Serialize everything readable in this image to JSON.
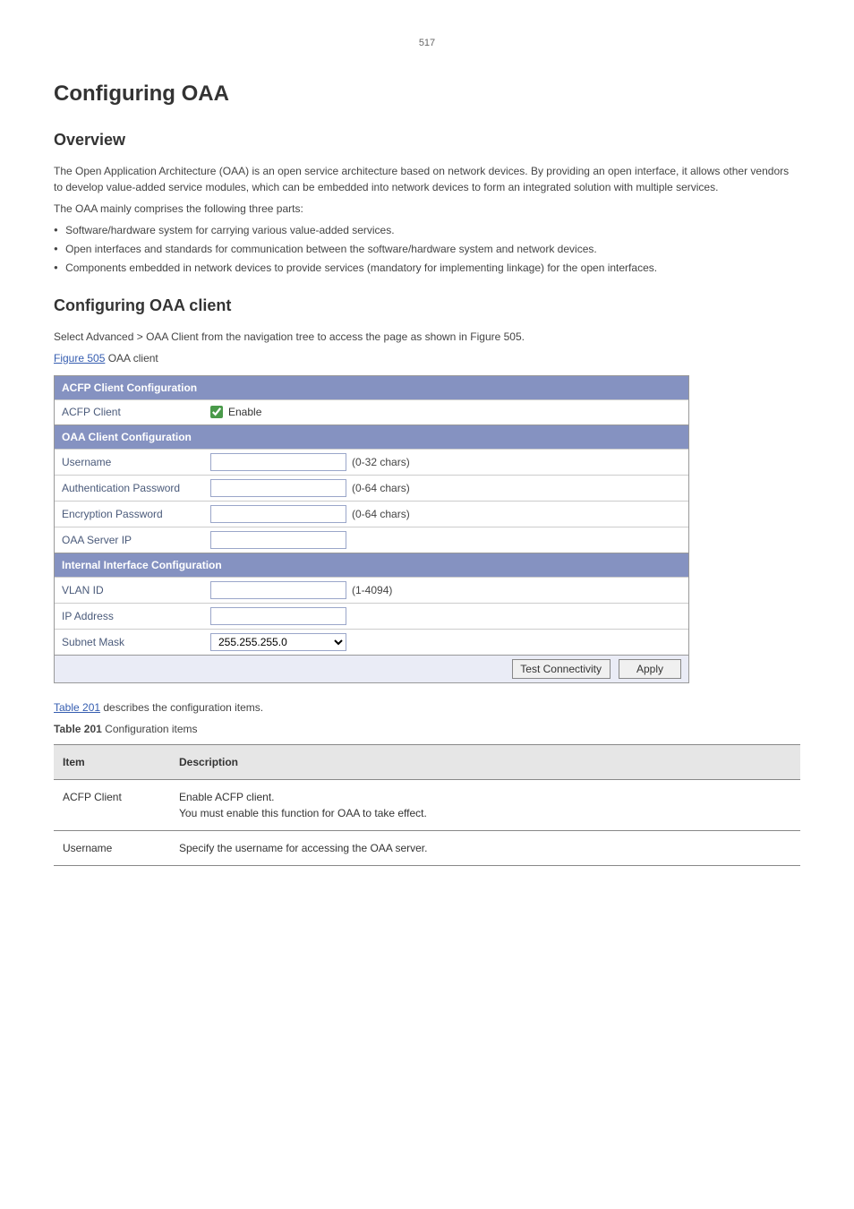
{
  "page_number": "517",
  "heading_main": "Configuring OAA",
  "heading_sub": "Overview",
  "para1": "The Open Application Architecture (OAA) is an open service architecture based on network devices. By providing an open interface, it allows other vendors to develop value-added service modules, which can be embedded into network devices to form an integrated solution with multiple services.",
  "para2": "The OAA mainly comprises the following three parts:",
  "bullets": [
    "Software/hardware system for carrying various value-added services.",
    "Open interfaces and standards for communication between the software/hardware system and network devices.",
    "Components embedded in network devices to provide services (mandatory for implementing linkage) for the open interfaces."
  ],
  "heading_proc": "Configuring OAA client",
  "proc_step": "Select Advanced > OAA Client from the navigation tree to access the page as shown in Figure 505.",
  "fig_label": "Figure 505",
  "fig_caption": "OAA client",
  "panel": {
    "section1": "ACFP Client Configuration",
    "acfp_client_label": "ACFP Client",
    "acfp_enable_label": "Enable",
    "section2": "OAA Client Configuration",
    "username_label": "Username",
    "username_hint": "(0-32 chars)",
    "authpw_label": "Authentication Password",
    "authpw_hint": "(0-64 chars)",
    "encpw_label": "Encryption Password",
    "encpw_hint": "(0-64 chars)",
    "oaa_ip_label": "OAA Server IP",
    "section3": "Internal Interface Configuration",
    "vlan_label": "VLAN ID",
    "vlan_hint": "(1-4094)",
    "ipaddr_label": "IP Address",
    "subnet_label": "Subnet Mask",
    "subnet_value": "255.255.255.0",
    "btn_test": "Test Connectivity",
    "btn_apply": "Apply"
  },
  "table_link": "Table 201",
  "table_sentence": " describes the configuration items.",
  "table_caption": "Configuration items",
  "table": {
    "headers": [
      "Item",
      "Description"
    ],
    "rows": [
      [
        "ACFP Client",
        "Enable ACFP client.\nYou must enable this function for OAA to take effect."
      ],
      [
        "Username",
        "Specify the username for accessing the OAA server."
      ]
    ]
  }
}
